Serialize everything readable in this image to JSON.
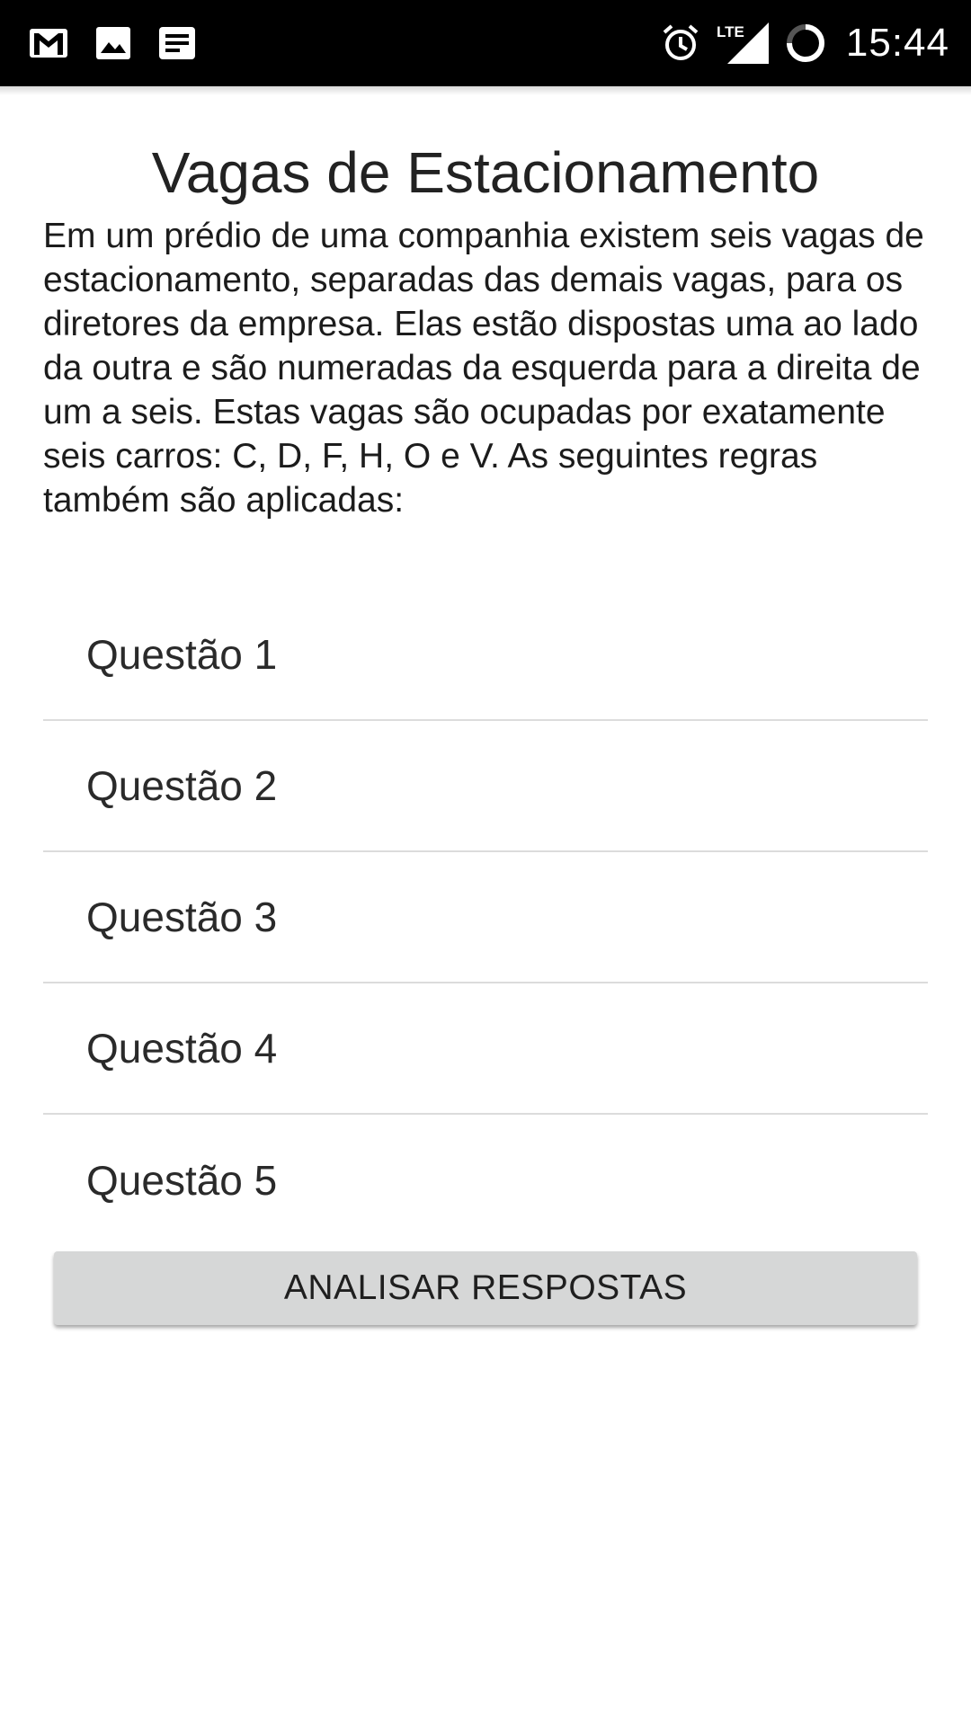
{
  "status_bar": {
    "left_icons": [
      "gmail-icon",
      "image-icon",
      "notes-icon"
    ],
    "right_icons": [
      "alarm-icon",
      "lte-signal-icon",
      "battery-loading-icon"
    ],
    "network_label": "LTE",
    "time": "15:44",
    "background_color": "#000000"
  },
  "page": {
    "title": "Vagas de Estacionamento",
    "description": "Em um prédio de uma companhia existem seis vagas de estacionamento, separadas das demais vagas, para os diretores da empresa. Elas estão dispostas uma ao lado da outra e são numeradas da esquerda para a direita de um a seis. Estas vagas são ocupadas por exatamente seis carros: C, D, F, H, O e V. As seguintes regras também são aplicadas:"
  },
  "questions": [
    {
      "label": "Questão 1"
    },
    {
      "label": "Questão 2"
    },
    {
      "label": "Questão 3"
    },
    {
      "label": "Questão 4"
    },
    {
      "label": "Questão 5"
    }
  ],
  "actions": {
    "analyze_label": "ANALISAR RESPOSTAS",
    "button_color": "#d6d7d7"
  }
}
